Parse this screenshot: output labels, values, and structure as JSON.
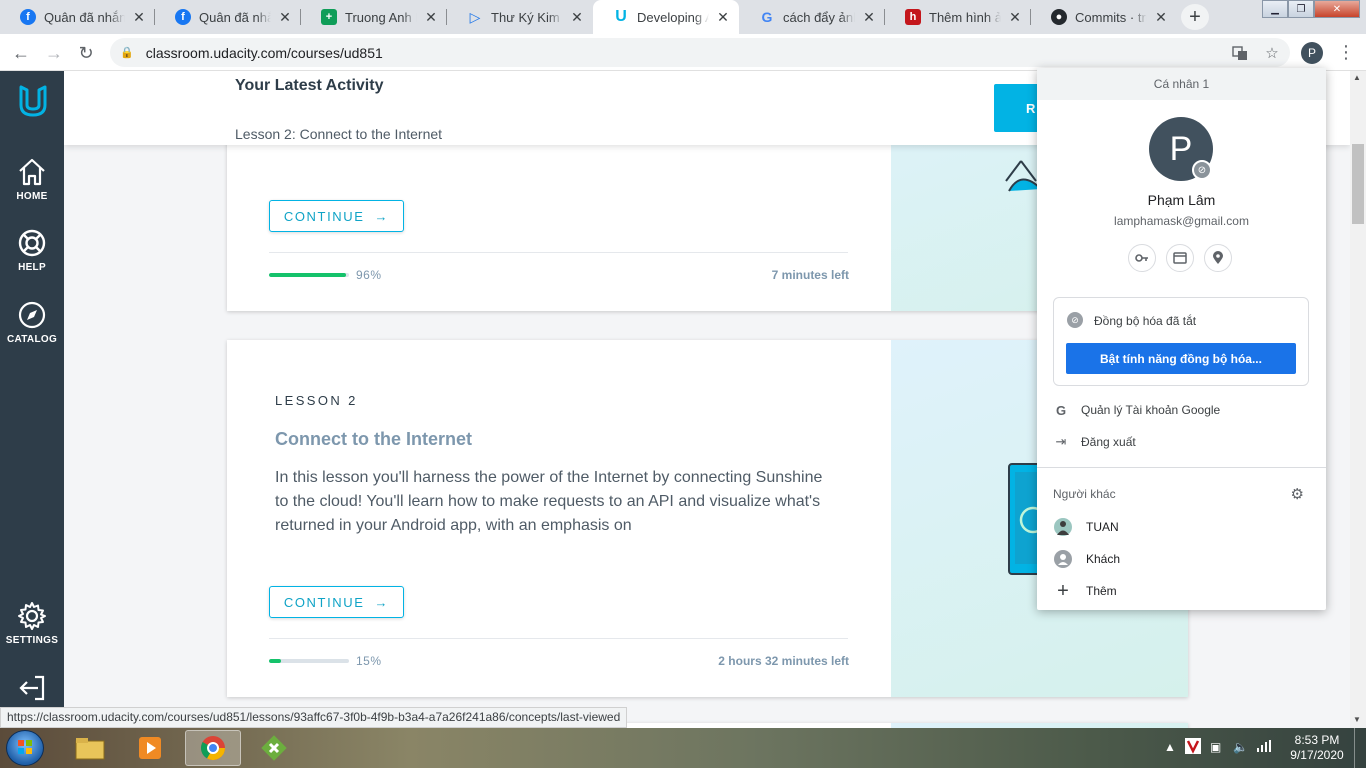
{
  "browser": {
    "tabs": [
      {
        "title": "Quân đã nhắn tin",
        "favicon": "facebook-icon",
        "color": "#1877f2"
      },
      {
        "title": "Quân đã nhắn tin",
        "favicon": "facebook-icon",
        "color": "#1877f2"
      },
      {
        "title": "Truong Anh Hoang",
        "favicon": "sheets-icon",
        "color": "#0f9d58"
      },
      {
        "title": "Thư Ký Kim Sao Thế",
        "favicon": "play-icon",
        "color": "#1a73e8"
      },
      {
        "title": "Developing Android Apps",
        "favicon": "udacity-icon",
        "color": "#02b3e4"
      },
      {
        "title": "cách đẩy ảnh lên",
        "favicon": "google-icon",
        "color": "#ea4335"
      },
      {
        "title": "Thêm hình ảnh vào",
        "favicon": "h-icon",
        "color": "#c4161c"
      },
      {
        "title": "Commits · truong",
        "favicon": "github-icon",
        "color": "#24292e"
      }
    ],
    "active_tab": 4,
    "url": "classroom.udacity.com/courses/ud851",
    "profile_initial": "P",
    "status_url": "https://classroom.udacity.com/courses/ud851/lessons/93affc67-3f0b-4f9b-b3a4-a7a26f241a86/concepts/last-viewed"
  },
  "sidebar": {
    "items": [
      {
        "label": "HOME",
        "icon": "home-icon"
      },
      {
        "label": "HELP",
        "icon": "lifebuoy-icon"
      },
      {
        "label": "CATALOG",
        "icon": "compass-icon"
      },
      {
        "label": "SETTINGS",
        "icon": "gear-icon"
      }
    ],
    "logout_icon": "logout-icon"
  },
  "activity": {
    "title": "Your Latest Activity",
    "lesson": "Lesson 2: Connect to the Internet",
    "resume_label": "R"
  },
  "cards": [
    {
      "continue_label": "CONTINUE",
      "progress": 0.96,
      "progress_text": "96%",
      "time_left": "7 minutes left"
    },
    {
      "tag": "LESSON 2",
      "title": "Connect to the Internet",
      "description": "In this lesson you'll harness the power of the Internet by connecting Sunshine to the cloud! You'll learn how to make requests to an API and visualize what's returned in your Android app, with an emphasis on",
      "continue_label": "CONTINUE",
      "progress": 0.15,
      "progress_text": "15%",
      "time_left": "2 hours 32 minutes left"
    }
  ],
  "profile_menu": {
    "header": "Cá nhân 1",
    "avatar_initial": "P",
    "name": "Phạm Lâm",
    "email": "lamphamask@gmail.com",
    "sync_state": "Đồng bộ hóa đã tắt",
    "sync_button": "Bật tính năng đồng bộ hóa...",
    "manage_account": "Quản lý Tài khoản Google",
    "sign_out": "Đăng xuất",
    "others_label": "Người khác",
    "people": [
      {
        "name": "TUAN",
        "icon": "user-avatar-icon"
      },
      {
        "name": "Khách",
        "icon": "guest-icon"
      },
      {
        "name": "Thêm",
        "icon": "plus-icon"
      }
    ]
  },
  "taskbar": {
    "time": "8:53 PM",
    "date": "9/17/2020"
  }
}
